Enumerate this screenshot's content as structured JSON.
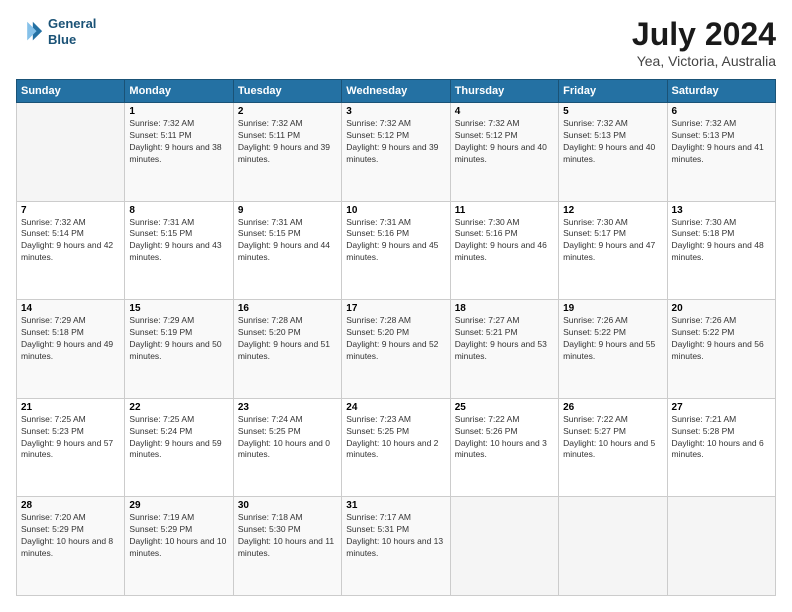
{
  "header": {
    "logo_line1": "General",
    "logo_line2": "Blue",
    "title": "July 2024",
    "subtitle": "Yea, Victoria, Australia"
  },
  "days_of_week": [
    "Sunday",
    "Monday",
    "Tuesday",
    "Wednesday",
    "Thursday",
    "Friday",
    "Saturday"
  ],
  "weeks": [
    [
      {
        "day": "",
        "sunrise": "",
        "sunset": "",
        "daylight": ""
      },
      {
        "day": "1",
        "sunrise": "Sunrise: 7:32 AM",
        "sunset": "Sunset: 5:11 PM",
        "daylight": "Daylight: 9 hours and 38 minutes."
      },
      {
        "day": "2",
        "sunrise": "Sunrise: 7:32 AM",
        "sunset": "Sunset: 5:11 PM",
        "daylight": "Daylight: 9 hours and 39 minutes."
      },
      {
        "day": "3",
        "sunrise": "Sunrise: 7:32 AM",
        "sunset": "Sunset: 5:12 PM",
        "daylight": "Daylight: 9 hours and 39 minutes."
      },
      {
        "day": "4",
        "sunrise": "Sunrise: 7:32 AM",
        "sunset": "Sunset: 5:12 PM",
        "daylight": "Daylight: 9 hours and 40 minutes."
      },
      {
        "day": "5",
        "sunrise": "Sunrise: 7:32 AM",
        "sunset": "Sunset: 5:13 PM",
        "daylight": "Daylight: 9 hours and 40 minutes."
      },
      {
        "day": "6",
        "sunrise": "Sunrise: 7:32 AM",
        "sunset": "Sunset: 5:13 PM",
        "daylight": "Daylight: 9 hours and 41 minutes."
      }
    ],
    [
      {
        "day": "7",
        "sunrise": "Sunrise: 7:32 AM",
        "sunset": "Sunset: 5:14 PM",
        "daylight": "Daylight: 9 hours and 42 minutes."
      },
      {
        "day": "8",
        "sunrise": "Sunrise: 7:31 AM",
        "sunset": "Sunset: 5:15 PM",
        "daylight": "Daylight: 9 hours and 43 minutes."
      },
      {
        "day": "9",
        "sunrise": "Sunrise: 7:31 AM",
        "sunset": "Sunset: 5:15 PM",
        "daylight": "Daylight: 9 hours and 44 minutes."
      },
      {
        "day": "10",
        "sunrise": "Sunrise: 7:31 AM",
        "sunset": "Sunset: 5:16 PM",
        "daylight": "Daylight: 9 hours and 45 minutes."
      },
      {
        "day": "11",
        "sunrise": "Sunrise: 7:30 AM",
        "sunset": "Sunset: 5:16 PM",
        "daylight": "Daylight: 9 hours and 46 minutes."
      },
      {
        "day": "12",
        "sunrise": "Sunrise: 7:30 AM",
        "sunset": "Sunset: 5:17 PM",
        "daylight": "Daylight: 9 hours and 47 minutes."
      },
      {
        "day": "13",
        "sunrise": "Sunrise: 7:30 AM",
        "sunset": "Sunset: 5:18 PM",
        "daylight": "Daylight: 9 hours and 48 minutes."
      }
    ],
    [
      {
        "day": "14",
        "sunrise": "Sunrise: 7:29 AM",
        "sunset": "Sunset: 5:18 PM",
        "daylight": "Daylight: 9 hours and 49 minutes."
      },
      {
        "day": "15",
        "sunrise": "Sunrise: 7:29 AM",
        "sunset": "Sunset: 5:19 PM",
        "daylight": "Daylight: 9 hours and 50 minutes."
      },
      {
        "day": "16",
        "sunrise": "Sunrise: 7:28 AM",
        "sunset": "Sunset: 5:20 PM",
        "daylight": "Daylight: 9 hours and 51 minutes."
      },
      {
        "day": "17",
        "sunrise": "Sunrise: 7:28 AM",
        "sunset": "Sunset: 5:20 PM",
        "daylight": "Daylight: 9 hours and 52 minutes."
      },
      {
        "day": "18",
        "sunrise": "Sunrise: 7:27 AM",
        "sunset": "Sunset: 5:21 PM",
        "daylight": "Daylight: 9 hours and 53 minutes."
      },
      {
        "day": "19",
        "sunrise": "Sunrise: 7:26 AM",
        "sunset": "Sunset: 5:22 PM",
        "daylight": "Daylight: 9 hours and 55 minutes."
      },
      {
        "day": "20",
        "sunrise": "Sunrise: 7:26 AM",
        "sunset": "Sunset: 5:22 PM",
        "daylight": "Daylight: 9 hours and 56 minutes."
      }
    ],
    [
      {
        "day": "21",
        "sunrise": "Sunrise: 7:25 AM",
        "sunset": "Sunset: 5:23 PM",
        "daylight": "Daylight: 9 hours and 57 minutes."
      },
      {
        "day": "22",
        "sunrise": "Sunrise: 7:25 AM",
        "sunset": "Sunset: 5:24 PM",
        "daylight": "Daylight: 9 hours and 59 minutes."
      },
      {
        "day": "23",
        "sunrise": "Sunrise: 7:24 AM",
        "sunset": "Sunset: 5:25 PM",
        "daylight": "Daylight: 10 hours and 0 minutes."
      },
      {
        "day": "24",
        "sunrise": "Sunrise: 7:23 AM",
        "sunset": "Sunset: 5:25 PM",
        "daylight": "Daylight: 10 hours and 2 minutes."
      },
      {
        "day": "25",
        "sunrise": "Sunrise: 7:22 AM",
        "sunset": "Sunset: 5:26 PM",
        "daylight": "Daylight: 10 hours and 3 minutes."
      },
      {
        "day": "26",
        "sunrise": "Sunrise: 7:22 AM",
        "sunset": "Sunset: 5:27 PM",
        "daylight": "Daylight: 10 hours and 5 minutes."
      },
      {
        "day": "27",
        "sunrise": "Sunrise: 7:21 AM",
        "sunset": "Sunset: 5:28 PM",
        "daylight": "Daylight: 10 hours and 6 minutes."
      }
    ],
    [
      {
        "day": "28",
        "sunrise": "Sunrise: 7:20 AM",
        "sunset": "Sunset: 5:29 PM",
        "daylight": "Daylight: 10 hours and 8 minutes."
      },
      {
        "day": "29",
        "sunrise": "Sunrise: 7:19 AM",
        "sunset": "Sunset: 5:29 PM",
        "daylight": "Daylight: 10 hours and 10 minutes."
      },
      {
        "day": "30",
        "sunrise": "Sunrise: 7:18 AM",
        "sunset": "Sunset: 5:30 PM",
        "daylight": "Daylight: 10 hours and 11 minutes."
      },
      {
        "day": "31",
        "sunrise": "Sunrise: 7:17 AM",
        "sunset": "Sunset: 5:31 PM",
        "daylight": "Daylight: 10 hours and 13 minutes."
      },
      {
        "day": "",
        "sunrise": "",
        "sunset": "",
        "daylight": ""
      },
      {
        "day": "",
        "sunrise": "",
        "sunset": "",
        "daylight": ""
      },
      {
        "day": "",
        "sunrise": "",
        "sunset": "",
        "daylight": ""
      }
    ]
  ]
}
